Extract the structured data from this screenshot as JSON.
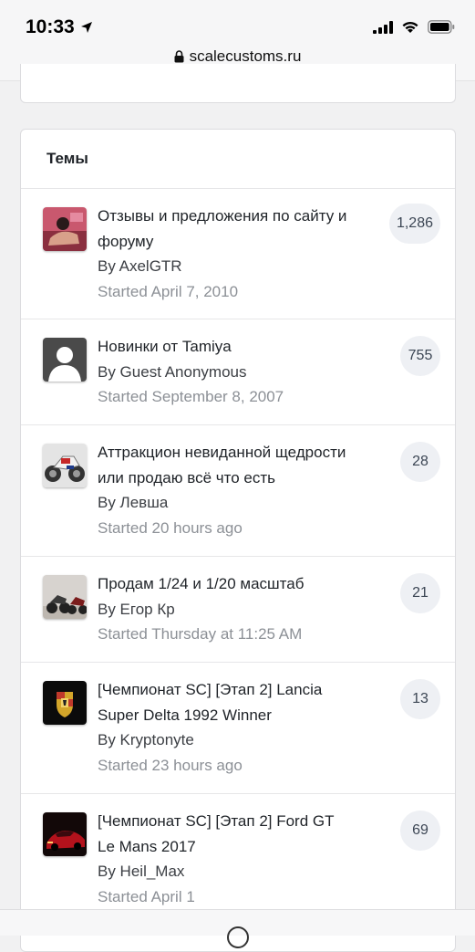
{
  "status_bar": {
    "time": "10:33",
    "url": "scalecustoms.ru"
  },
  "topics": {
    "heading": "Темы",
    "items": [
      {
        "title_lines": [
          "Отзывы и предложения по сайту и",
          "форуму"
        ],
        "author": "By AxelGTR",
        "started": "Started April 7, 2010",
        "count": "1,286",
        "avatar": "person-photo-avatar"
      },
      {
        "title_lines": [
          "Новинки от Tamiya"
        ],
        "author": "By Guest Anonymous",
        "started": "Started September 8, 2007",
        "count": "755",
        "avatar": "default-user-avatar"
      },
      {
        "title_lines": [
          "Аттракцион невиданной щедрости",
          "или продаю всё что есть"
        ],
        "author": "By Левша",
        "started": "Started 20 hours ago",
        "count": "28",
        "avatar": "motorcycle-photo-avatar"
      },
      {
        "title_lines": [
          "Продам 1/24 и 1/20 масштаб"
        ],
        "author": "By Егор Кр",
        "started": "Started Thursday at 11:25 AM",
        "count": "21",
        "avatar": "motorcycles-photo-avatar"
      },
      {
        "title_lines": [
          "[Чемпионат SC] [Этап 2] Lancia",
          "Super Delta 1992 Winner"
        ],
        "author": "By Kryptonyte",
        "started": "Started 23 hours ago",
        "count": "13",
        "avatar": "porsche-crest-avatar"
      },
      {
        "title_lines": [
          "[Чемпионат SC] [Этап 2] Ford GT",
          "Le Mans 2017"
        ],
        "author": "By Heil_Max",
        "started": "Started April 1",
        "count": "69",
        "avatar": "red-car-photo-avatar"
      }
    ]
  }
}
